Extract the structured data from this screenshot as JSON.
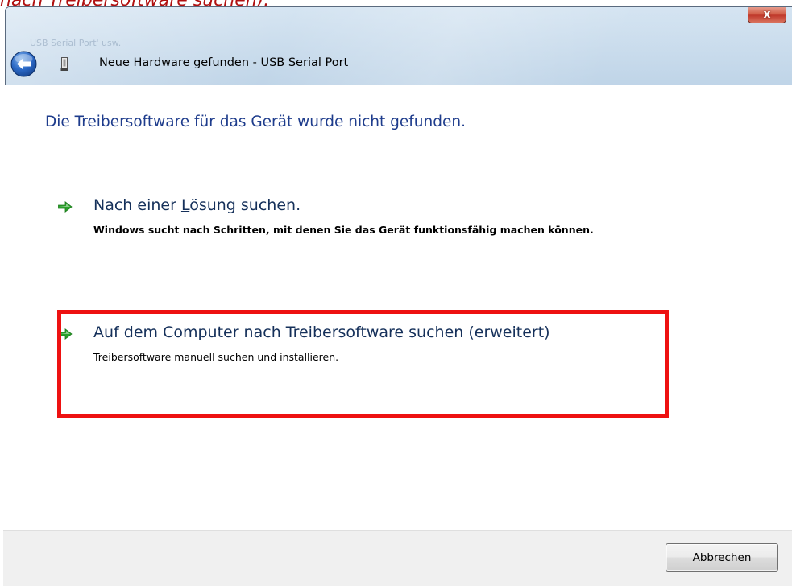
{
  "caption_top": "nach Treibersoftware suchen).",
  "window": {
    "close_glyph": "x",
    "ghost_text": "USB Serial Port' usw.",
    "nav_title": "Neue Hardware gefunden - USB Serial Port",
    "back_icon": "back-arrow-icon",
    "device_icon": "usb-device-icon"
  },
  "content": {
    "headline": "Die Treibersoftware für das Gerät wurde nicht gefunden.",
    "options": [
      {
        "title_prefix": "Nach einer ",
        "title_accel": "L",
        "title_suffix": "ösung suchen.",
        "description": "Windows sucht nach Schritten, mit denen Sie das Gerät funktionsfähig machen können.",
        "icon": "green-arrow-icon"
      },
      {
        "title": "Auf dem Computer nach Treibersoftware suchen (erweitert)",
        "description": "Treibersoftware manuell suchen und installieren.",
        "icon": "green-arrow-icon"
      }
    ]
  },
  "footer": {
    "cancel_label": "Abbrechen"
  },
  "colors": {
    "headline": "#1e3c8c",
    "highlight": "#ee1111",
    "arrow": "#2aa12a",
    "caption": "#b01010"
  }
}
